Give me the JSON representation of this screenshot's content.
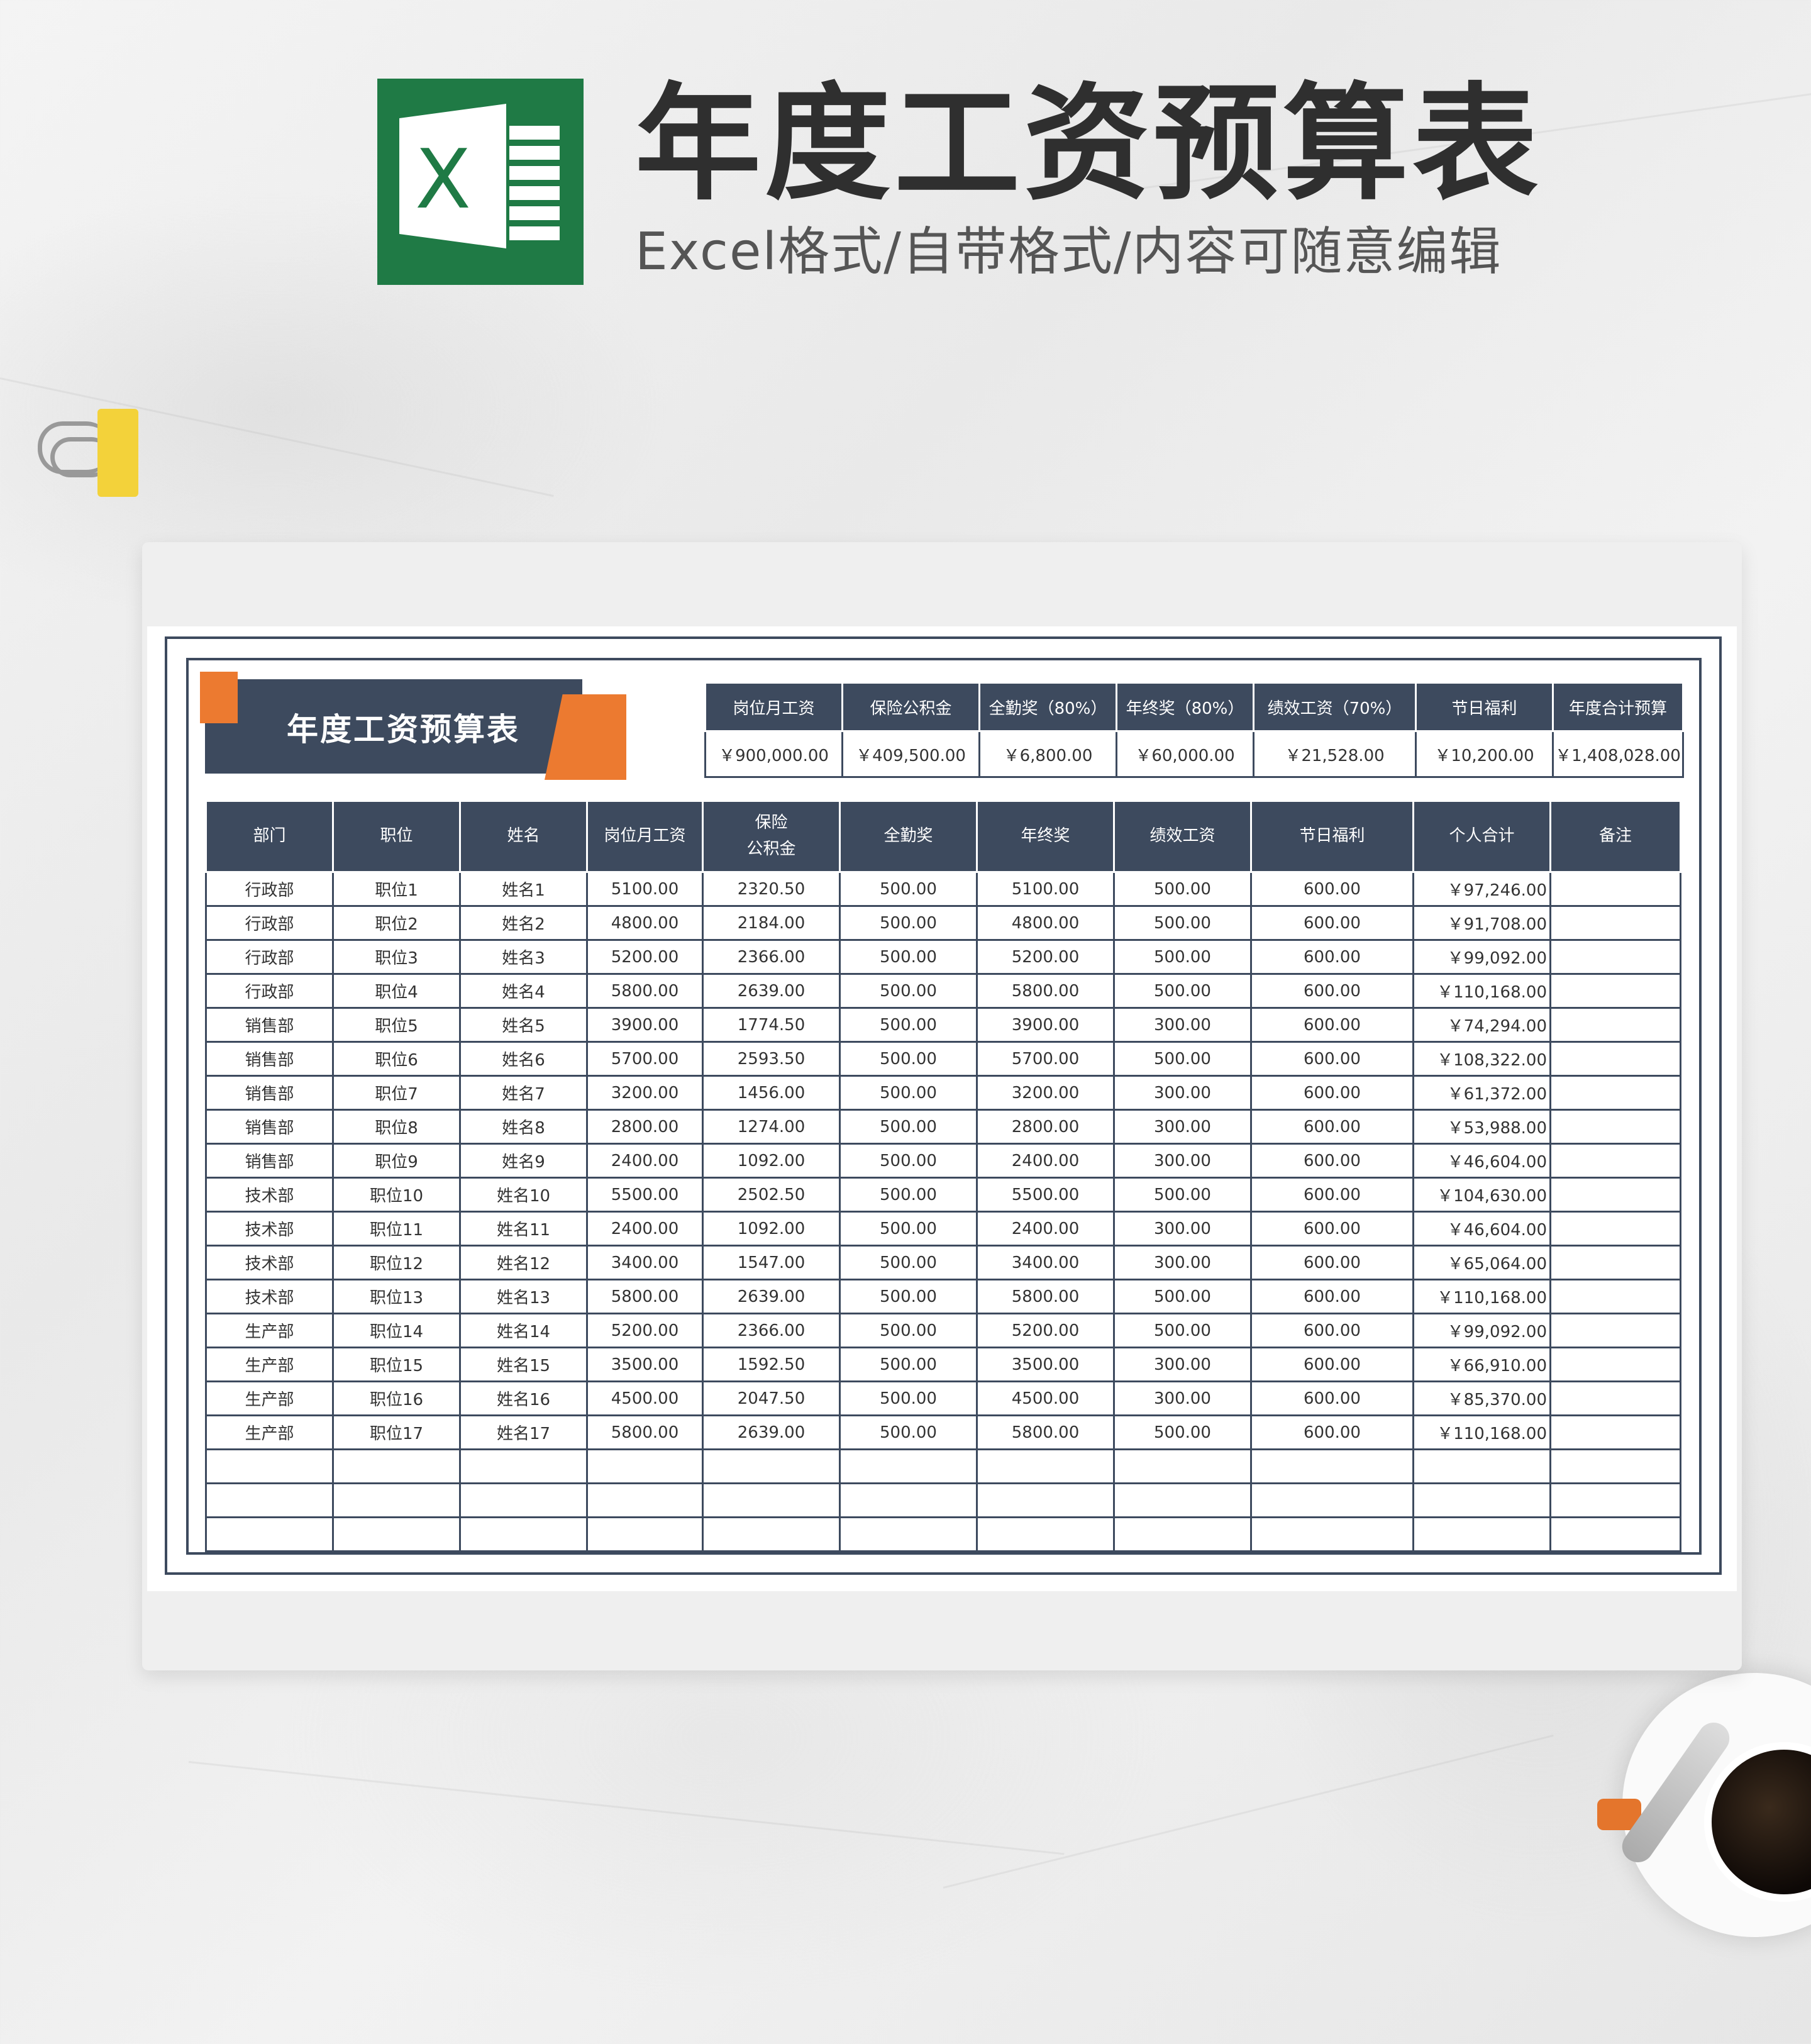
{
  "header": {
    "title": "年度工资预算表",
    "subtitle": "Excel格式/自带格式/内容可随意编辑",
    "logo_letter": "X"
  },
  "colors": {
    "navy": "#3d4a5e",
    "orange": "#ec7a30",
    "excel_green": "#1f7a45"
  },
  "icons": [
    "excel-logo-icon",
    "binder-clip-icon",
    "coffee-cup-icon"
  ],
  "sheet": {
    "title": "年度工资预算表",
    "summary": {
      "headers": [
        "岗位月工资",
        "保险公积金",
        "全勤奖（80%）",
        "年终奖（80%）",
        "绩效工资（70%）",
        "节日福利",
        "年度合计预算"
      ],
      "values": [
        "￥900,000.00",
        "￥409,500.00",
        "￥6,800.00",
        "￥60,000.00",
        "￥21,528.00",
        "￥10,200.00",
        "￥1,408,028.00"
      ]
    },
    "table": {
      "headers": [
        "部门",
        "职位",
        "姓名",
        "岗位月工资",
        "保险\n公积金",
        "全勤奖",
        "年终奖",
        "绩效工资",
        "节日福利",
        "个人合计",
        "备注"
      ],
      "rows": [
        [
          "行政部",
          "职位1",
          "姓名1",
          "5100.00",
          "2320.50",
          "500.00",
          "5100.00",
          "500.00",
          "600.00",
          "￥97,246.00",
          ""
        ],
        [
          "行政部",
          "职位2",
          "姓名2",
          "4800.00",
          "2184.00",
          "500.00",
          "4800.00",
          "500.00",
          "600.00",
          "￥91,708.00",
          ""
        ],
        [
          "行政部",
          "职位3",
          "姓名3",
          "5200.00",
          "2366.00",
          "500.00",
          "5200.00",
          "500.00",
          "600.00",
          "￥99,092.00",
          ""
        ],
        [
          "行政部",
          "职位4",
          "姓名4",
          "5800.00",
          "2639.00",
          "500.00",
          "5800.00",
          "500.00",
          "600.00",
          "￥110,168.00",
          ""
        ],
        [
          "销售部",
          "职位5",
          "姓名5",
          "3900.00",
          "1774.50",
          "500.00",
          "3900.00",
          "300.00",
          "600.00",
          "￥74,294.00",
          ""
        ],
        [
          "销售部",
          "职位6",
          "姓名6",
          "5700.00",
          "2593.50",
          "500.00",
          "5700.00",
          "500.00",
          "600.00",
          "￥108,322.00",
          ""
        ],
        [
          "销售部",
          "职位7",
          "姓名7",
          "3200.00",
          "1456.00",
          "500.00",
          "3200.00",
          "300.00",
          "600.00",
          "￥61,372.00",
          ""
        ],
        [
          "销售部",
          "职位8",
          "姓名8",
          "2800.00",
          "1274.00",
          "500.00",
          "2800.00",
          "300.00",
          "600.00",
          "￥53,988.00",
          ""
        ],
        [
          "销售部",
          "职位9",
          "姓名9",
          "2400.00",
          "1092.00",
          "500.00",
          "2400.00",
          "300.00",
          "600.00",
          "￥46,604.00",
          ""
        ],
        [
          "技术部",
          "职位10",
          "姓名10",
          "5500.00",
          "2502.50",
          "500.00",
          "5500.00",
          "500.00",
          "600.00",
          "￥104,630.00",
          ""
        ],
        [
          "技术部",
          "职位11",
          "姓名11",
          "2400.00",
          "1092.00",
          "500.00",
          "2400.00",
          "300.00",
          "600.00",
          "￥46,604.00",
          ""
        ],
        [
          "技术部",
          "职位12",
          "姓名12",
          "3400.00",
          "1547.00",
          "500.00",
          "3400.00",
          "300.00",
          "600.00",
          "￥65,064.00",
          ""
        ],
        [
          "技术部",
          "职位13",
          "姓名13",
          "5800.00",
          "2639.00",
          "500.00",
          "5800.00",
          "500.00",
          "600.00",
          "￥110,168.00",
          ""
        ],
        [
          "生产部",
          "职位14",
          "姓名14",
          "5200.00",
          "2366.00",
          "500.00",
          "5200.00",
          "500.00",
          "600.00",
          "￥99,092.00",
          ""
        ],
        [
          "生产部",
          "职位15",
          "姓名15",
          "3500.00",
          "1592.50",
          "500.00",
          "3500.00",
          "300.00",
          "600.00",
          "￥66,910.00",
          ""
        ],
        [
          "生产部",
          "职位16",
          "姓名16",
          "4500.00",
          "2047.50",
          "500.00",
          "4500.00",
          "300.00",
          "600.00",
          "￥85,370.00",
          ""
        ],
        [
          "生产部",
          "职位17",
          "姓名17",
          "5800.00",
          "2639.00",
          "500.00",
          "5800.00",
          "500.00",
          "600.00",
          "￥110,168.00",
          ""
        ],
        [
          "",
          "",
          "",
          "",
          "",
          "",
          "",
          "",
          "",
          "",
          ""
        ],
        [
          "",
          "",
          "",
          "",
          "",
          "",
          "",
          "",
          "",
          "",
          ""
        ],
        [
          "",
          "",
          "",
          "",
          "",
          "",
          "",
          "",
          "",
          "",
          ""
        ]
      ]
    }
  }
}
